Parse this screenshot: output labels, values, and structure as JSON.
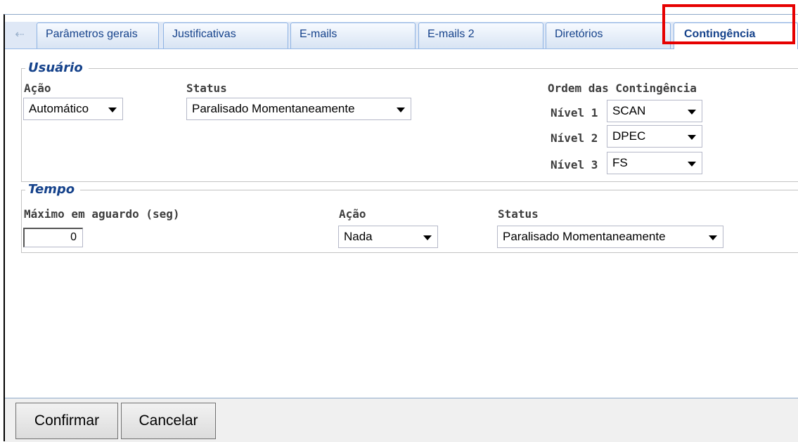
{
  "tabs": [
    {
      "label": "Parâmetros gerais"
    },
    {
      "label": "Justificativas"
    },
    {
      "label": "E-mails"
    },
    {
      "label": "E-mails 2"
    },
    {
      "label": "Diretórios"
    },
    {
      "label": "Contingência",
      "active": true
    }
  ],
  "usuario": {
    "legend": "Usuário",
    "acao_label": "Ação",
    "acao_value": "Automático",
    "status_label": "Status",
    "status_value": "Paralisado Momentaneamente",
    "ordem_label": "Ordem das Contingência",
    "niveis": [
      {
        "label": "Nível 1",
        "value": "SCAN"
      },
      {
        "label": "Nível 2",
        "value": "DPEC"
      },
      {
        "label": "Nível 3",
        "value": "FS"
      }
    ]
  },
  "tempo": {
    "legend": "Tempo",
    "maximo_label": "Máximo em aguardo (seg)",
    "maximo_value": "0",
    "acao_label": "Ação",
    "acao_value": "Nada",
    "status_label": "Status",
    "status_value": "Paralisado Momentaneamente"
  },
  "buttons": {
    "confirm": "Confirmar",
    "cancel": "Cancelar"
  },
  "colors": {
    "accent": "#15428b",
    "highlight": "#e60000"
  }
}
